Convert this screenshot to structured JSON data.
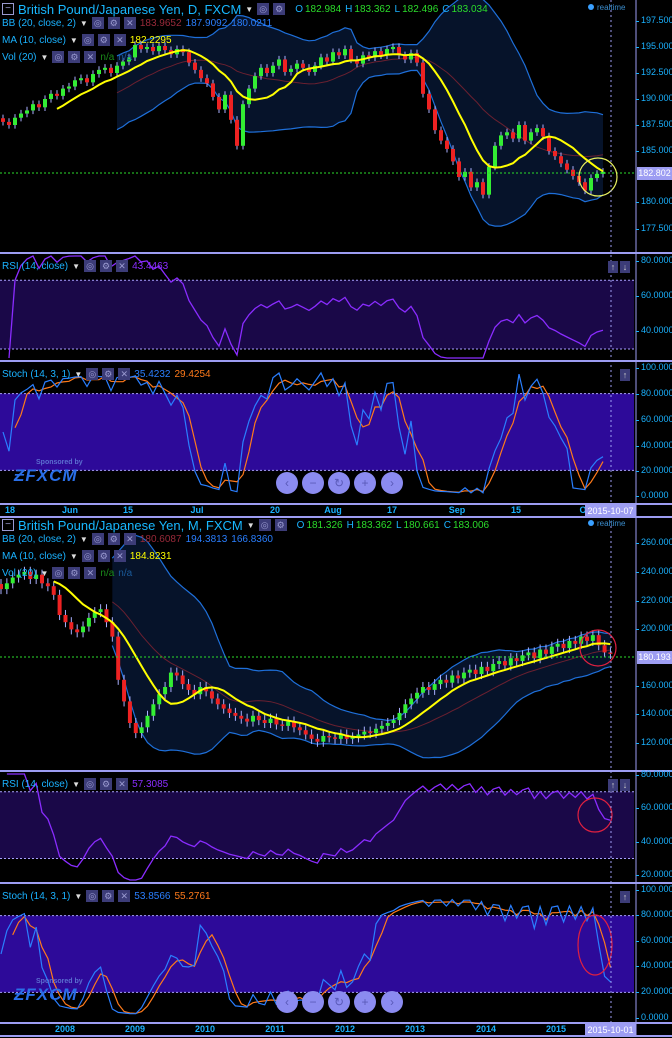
{
  "colors": {
    "background": "#000000",
    "up": "#33ee33",
    "down": "#ee2222",
    "ma": "#ffff00",
    "bb": "#1e6fd9",
    "bb_mid": "#6a2030",
    "rsi": "#8a2cff",
    "stoch_k": "#2a7fff",
    "stoch_d": "#ff7a1a",
    "band": "#2d0a99",
    "rsi_band": "#1a0848",
    "highlight_daily": "#e8f060",
    "highlight_monthly": "#e02040"
  },
  "panels": [
    {
      "title": "British Pound/Japanese Yen, D, FXCM",
      "ohlc": {
        "o": "182.984",
        "h": "183.362",
        "l": "182.496",
        "c": "183.034"
      },
      "realtime": "realtime",
      "bb": {
        "label": "BB (20, close, 2)",
        "v1": "183.9652",
        "v2": "187.9092",
        "v3": "180.0211"
      },
      "ma": {
        "label": "MA (10, close)",
        "v": "182.2295"
      },
      "vol": {
        "label": "Vol (20)",
        "v1": "n/a",
        "v2": "n/a"
      },
      "rsi": {
        "label": "RSI (14, close)",
        "v": "43.4463",
        "ticks": [
          "80.0000",
          "60.0000",
          "40.0000"
        ]
      },
      "stoch": {
        "label": "Stoch (14, 3, 1)",
        "k": "35.4232",
        "d": "29.4254",
        "ticks": [
          "100.0000",
          "80.0000",
          "60.0000",
          "40.0000",
          "20.0000",
          "0.0000"
        ]
      },
      "price_ticks": [
        "197.500",
        "195.000",
        "192.500",
        "190.000",
        "187.500",
        "185.000",
        "180.000",
        "177.500"
      ],
      "last_price": "182.802",
      "x_ticks": [
        "18",
        "Jun",
        "15",
        "Jul",
        "20",
        "Aug",
        "17",
        "Sep",
        "15",
        "O"
      ],
      "cursor_date": "2015-10-07",
      "sponsor": {
        "line1": "Sponsored by",
        "line2": "FXCM"
      },
      "nav": [
        "‹",
        "−",
        "↻",
        "+",
        "›"
      ]
    },
    {
      "title": "British Pound/Japanese Yen, M, FXCM",
      "ohlc": {
        "o": "181.326",
        "h": "183.362",
        "l": "180.661",
        "c": "183.006"
      },
      "realtime": "realtime",
      "bb": {
        "label": "BB (20, close, 2)",
        "v1": "180.6087",
        "v2": "194.3813",
        "v3": "166.8360"
      },
      "ma": {
        "label": "MA (10, close)",
        "v": "184.8231"
      },
      "vol": {
        "label": "Vol (20)",
        "v1": "n/a",
        "v2": "n/a"
      },
      "rsi": {
        "label": "RSI (14, close)",
        "v": "57.3085",
        "ticks": [
          "80.0000",
          "60.0000",
          "40.0000",
          "20.0000"
        ]
      },
      "stoch": {
        "label": "Stoch (14, 3, 1)",
        "k": "53.8566",
        "d": "55.2761",
        "ticks": [
          "100.0000",
          "80.0000",
          "60.0000",
          "40.0000",
          "20.0000",
          "0.0000"
        ]
      },
      "price_ticks": [
        "260.000",
        "240.000",
        "220.000",
        "200.000",
        "160.000",
        "140.000",
        "120.000"
      ],
      "last_price": "180.193",
      "x_ticks": [
        "2008",
        "2009",
        "2010",
        "2011",
        "2012",
        "2013",
        "2014",
        "2015"
      ],
      "cursor_date": "2015-10-01",
      "sponsor": {
        "line1": "Sponsored by",
        "line2": "FXCM"
      },
      "nav": [
        "‹",
        "−",
        "↻",
        "+",
        "›"
      ]
    }
  ],
  "chart_data": [
    {
      "type": "candlestick",
      "timeframe": "D",
      "ylim": [
        176,
        199
      ],
      "closes": [
        187.8,
        187.5,
        188.2,
        188.6,
        188.9,
        189.5,
        189.2,
        190.0,
        190.5,
        190.3,
        191.0,
        191.2,
        191.8,
        192.0,
        191.6,
        192.4,
        192.8,
        193.0,
        192.5,
        193.2,
        193.6,
        194.0,
        195.2,
        194.8,
        195.0,
        194.6,
        195.1,
        194.7,
        194.3,
        194.8,
        194.5,
        193.5,
        192.8,
        192.0,
        191.5,
        190.2,
        189.0,
        190.4,
        188.0,
        185.5,
        189.5,
        191.0,
        192.2,
        193.0,
        192.5,
        193.2,
        193.8,
        192.6,
        192.9,
        193.4,
        193.0,
        192.6,
        193.2,
        194.0,
        193.6,
        194.5,
        194.2,
        194.8,
        193.8,
        193.4,
        194.2,
        194.0,
        194.6,
        194.2,
        194.8,
        195.0,
        194.2,
        193.8,
        194.4,
        193.5,
        190.5,
        189.0,
        187.0,
        186.0,
        185.2,
        184.0,
        182.5,
        183.0,
        181.5,
        182.0,
        180.8,
        183.5,
        185.5,
        186.5,
        186.8,
        186.2,
        187.5,
        186.0,
        186.8,
        187.2,
        186.4,
        185.0,
        184.5,
        183.8,
        183.2,
        182.6,
        182.0,
        181.2,
        182.4,
        182.8,
        183.0
      ],
      "indicators": [
        "BB (20, close, 2)",
        "MA (10, close)",
        "RSI (14, close)",
        "Stoch (14, 3, 1)"
      ],
      "rsi_levels": [
        70,
        30
      ],
      "stoch_levels": [
        80,
        20
      ]
    },
    {
      "type": "candlestick",
      "timeframe": "M",
      "ylim": [
        110,
        270
      ],
      "closes": [
        228,
        232,
        236,
        238,
        240,
        235,
        238,
        232,
        230,
        224,
        210,
        205,
        200,
        198,
        202,
        208,
        212,
        214,
        205,
        195,
        165,
        150,
        135,
        128,
        132,
        140,
        148,
        155,
        160,
        170,
        168,
        162,
        158,
        155,
        160,
        157,
        152,
        148,
        145,
        142,
        140,
        138,
        136,
        140,
        137,
        135,
        138,
        134,
        133,
        136,
        132,
        130,
        127,
        124,
        122,
        126,
        125,
        124,
        127,
        124,
        125,
        127,
        129,
        128,
        131,
        133,
        135,
        137,
        142,
        148,
        152,
        156,
        160,
        158,
        162,
        165,
        163,
        168,
        166,
        170,
        172,
        169,
        174,
        171,
        176,
        178,
        175,
        180,
        178,
        182,
        184,
        180,
        186,
        183,
        188,
        190,
        187,
        192,
        190,
        195,
        192,
        196,
        189,
        184,
        183
      ],
      "indicators": [
        "BB (20, close, 2)",
        "MA (10, close)",
        "RSI (14, close)",
        "Stoch (14, 3, 1)"
      ],
      "rsi_levels": [
        70,
        30
      ],
      "stoch_levels": [
        80,
        20
      ]
    }
  ]
}
